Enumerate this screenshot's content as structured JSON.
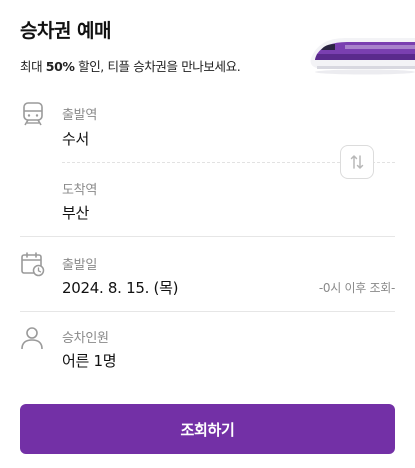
{
  "header": {
    "title": "승차권 예매",
    "subtitle_prefix": "최대",
    "subtitle_bold": "50%",
    "subtitle_rest": "할인, 티플 승차권을 만나보세요."
  },
  "route": {
    "departure_label": "출발역",
    "departure_value": "수서",
    "arrival_label": "도착역",
    "arrival_value": "부산"
  },
  "date": {
    "label": "출발일",
    "value": "2024. 8. 15. (목)",
    "hint": "-0시 이후 조회-"
  },
  "passengers": {
    "label": "승차인원",
    "value": "어른 1명"
  },
  "cta": {
    "label": "조회하기"
  },
  "colors": {
    "accent": "#7330A6",
    "label": "#8a8a8a",
    "divider": "#e6e6e6"
  },
  "icons": {
    "train": "train-icon",
    "calendar": "calendar-icon",
    "person": "person-icon",
    "swap": "swap-icon"
  }
}
